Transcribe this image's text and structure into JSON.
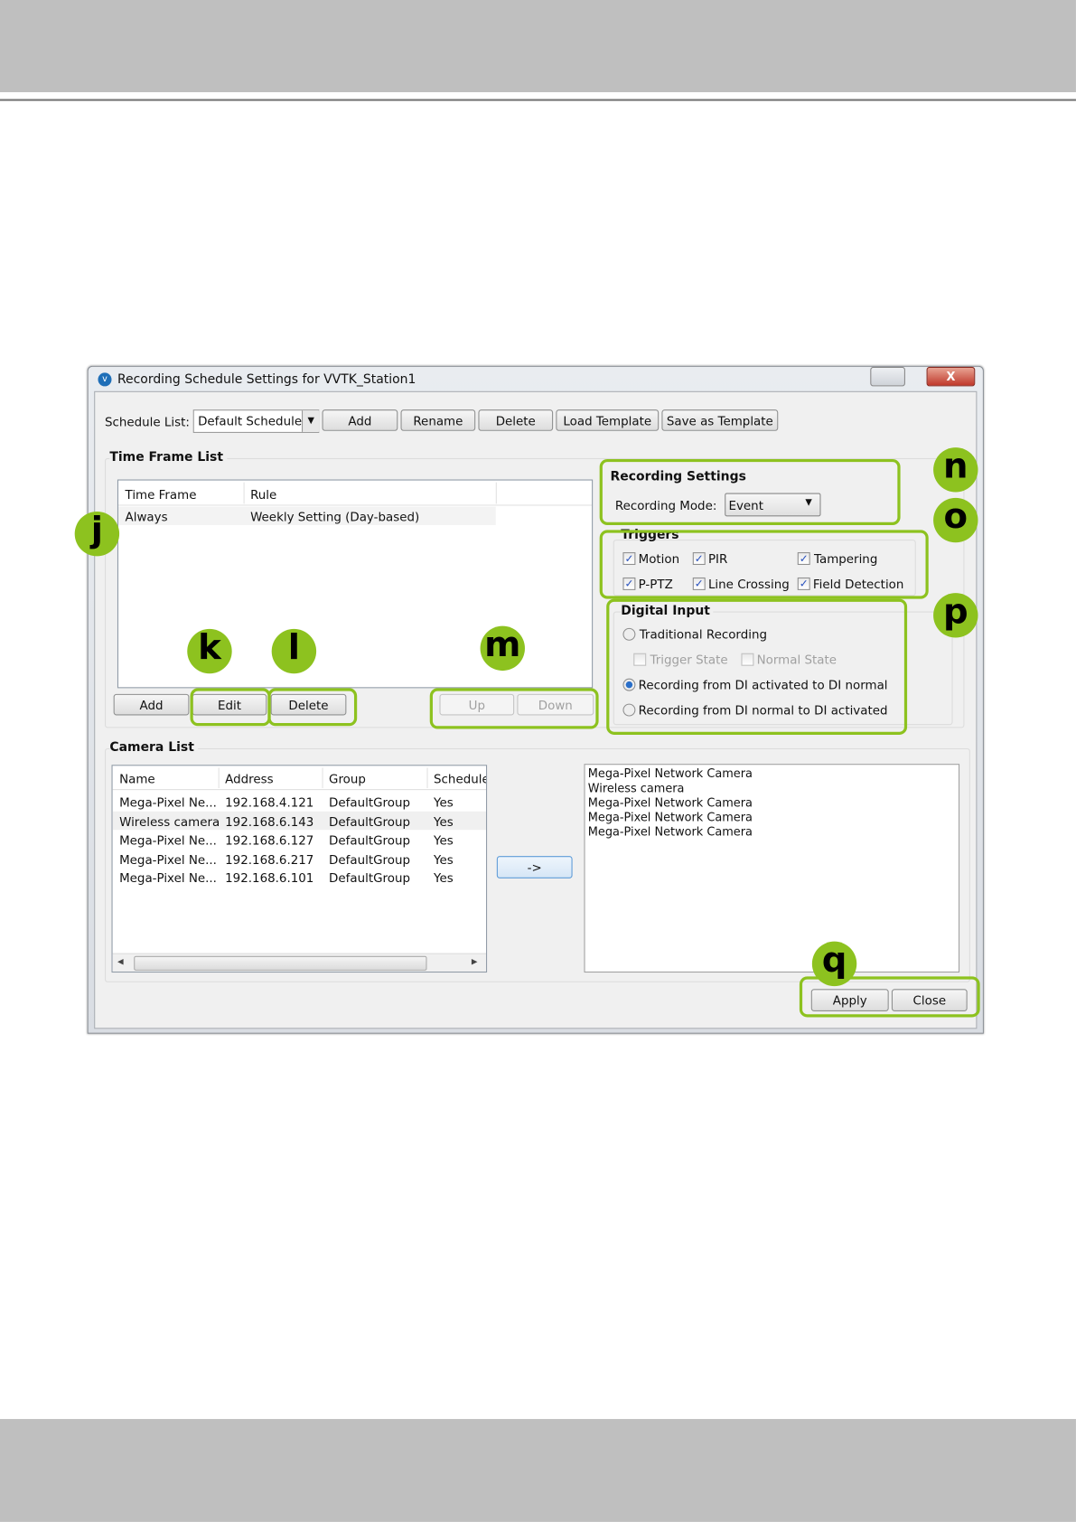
{
  "window": {
    "title": "Recording Schedule Settings for VVTK_Station1",
    "close_label": "X"
  },
  "schedule": {
    "label": "Schedule List:",
    "selected": "Default Schedule",
    "buttons": [
      "Add",
      "Rename",
      "Delete",
      "Load Template",
      "Save as Template"
    ]
  },
  "time_frame": {
    "title": "Time Frame List",
    "columns": [
      "Time Frame",
      "Rule"
    ],
    "rows": [
      [
        "Always",
        "Weekly Setting (Day-based)"
      ]
    ],
    "buttons": {
      "add": "Add",
      "edit": "Edit",
      "delete": "Delete",
      "up": "Up",
      "down": "Down"
    }
  },
  "recording": {
    "title": "Recording Settings",
    "mode_label": "Recording Mode:",
    "mode": "Event"
  },
  "triggers": {
    "title": "Triggers",
    "items": [
      {
        "label": "Motion",
        "checked": true
      },
      {
        "label": "PIR",
        "checked": true
      },
      {
        "label": "Tampering",
        "checked": true
      },
      {
        "label": "P-PTZ",
        "checked": true
      },
      {
        "label": "Line Crossing",
        "checked": true
      },
      {
        "label": "Field Detection",
        "checked": true
      }
    ]
  },
  "digital_input": {
    "title": "Digital Input",
    "traditional": "Traditional Recording",
    "trigger_state": "Trigger State",
    "normal_state": "Normal State",
    "option_a": "Recording from DI activated to DI normal",
    "option_b": "Recording from DI normal to DI activated",
    "selected": "option_a"
  },
  "camera_list": {
    "title": "Camera List",
    "columns": [
      "Name",
      "Address",
      "Group",
      "Schedule"
    ],
    "rows": [
      [
        "Mega-Pixel Ne...",
        "192.168.4.121",
        "DefaultGroup",
        "Yes"
      ],
      [
        "Wireless camera",
        "192.168.6.143",
        "DefaultGroup",
        "Yes"
      ],
      [
        "Mega-Pixel Ne...",
        "192.168.6.127",
        "DefaultGroup",
        "Yes"
      ],
      [
        "Mega-Pixel Ne...",
        "192.168.6.217",
        "DefaultGroup",
        "Yes"
      ],
      [
        "Mega-Pixel Ne...",
        "192.168.6.101",
        "DefaultGroup",
        "Yes"
      ]
    ],
    "move_label": "->",
    "assigned": [
      "Mega-Pixel Network Camera",
      "Wireless camera",
      "Mega-Pixel Network Camera",
      "Mega-Pixel Network Camera",
      "Mega-Pixel Network Camera"
    ]
  },
  "footer": {
    "apply": "Apply",
    "close": "Close"
  },
  "annotations": {
    "j": "j",
    "k": "k",
    "l": "l",
    "m": "m",
    "n": "n",
    "o": "o",
    "p": "p",
    "q": "q",
    "color": "#8dc21f"
  }
}
